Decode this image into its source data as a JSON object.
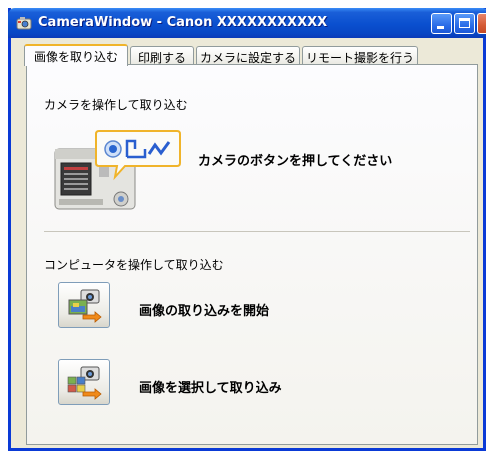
{
  "window": {
    "title": "CameraWindow - Canon XXXXXXXXXXX"
  },
  "tabs": [
    {
      "label": "画像を取り込む",
      "active": true
    },
    {
      "label": "印刷する",
      "active": false
    },
    {
      "label": "カメラに設定する",
      "active": false
    },
    {
      "label": "リモート撮影を行う",
      "active": false
    }
  ],
  "camera_section": {
    "heading": "カメラを操作して取り込む",
    "instruction": "カメラのボタンを押してください"
  },
  "computer_section": {
    "heading": "コンピュータを操作して取り込む",
    "start_import_label": "画像の取り込みを開始",
    "select_import_label": "画像を選択して取り込み"
  },
  "colors": {
    "titlebar": "#0a4fcf",
    "active_tab_accent": "#f0b42a",
    "window_bg": "#ece9d8",
    "panel_border": "#919b9c"
  },
  "icons": {
    "app": "camera-window-icon",
    "minimize": "minimize-icon",
    "maximize": "maximize-icon",
    "close": "close-icon",
    "start_import": "camera-import-icon",
    "select_import": "camera-select-import-icon",
    "illustration": "camera-button-illustration"
  }
}
